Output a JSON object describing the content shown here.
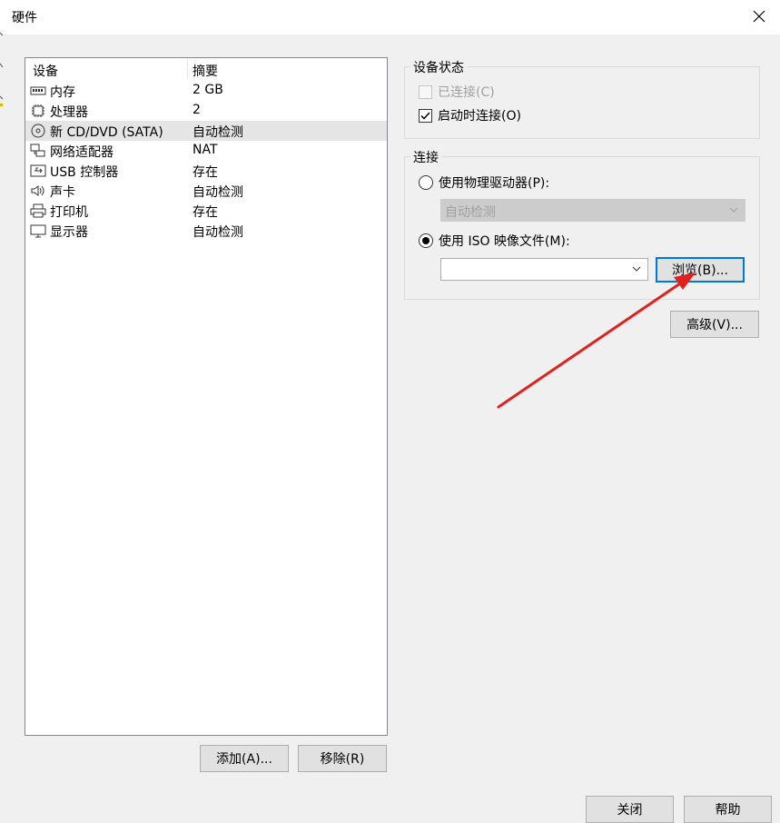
{
  "window": {
    "title": "硬件"
  },
  "device_list": {
    "columns": [
      "设备",
      "摘要"
    ],
    "rows": [
      {
        "name": "内存",
        "summary": "2 GB",
        "icon": "memory-icon",
        "selected": false
      },
      {
        "name": "处理器",
        "summary": "2",
        "icon": "cpu-icon",
        "selected": false
      },
      {
        "name": "新 CD/DVD (SATA)",
        "summary": "自动检测",
        "icon": "cd-dvd-icon",
        "selected": true
      },
      {
        "name": "网络适配器",
        "summary": "NAT",
        "icon": "network-adapter-icon",
        "selected": false
      },
      {
        "name": "USB 控制器",
        "summary": "存在",
        "icon": "usb-icon",
        "selected": false
      },
      {
        "name": "声卡",
        "summary": "自动检测",
        "icon": "speaker-icon",
        "selected": false
      },
      {
        "name": "打印机",
        "summary": "存在",
        "icon": "printer-icon",
        "selected": false
      },
      {
        "name": "显示器",
        "summary": "自动检测",
        "icon": "monitor-icon",
        "selected": false
      }
    ],
    "add_label": "添加(A)...",
    "remove_label": "移除(R)"
  },
  "device_status": {
    "title": "设备状态",
    "connected_label": "已连接(C)",
    "connected_checked": false,
    "connected_disabled": true,
    "connect_at_poweron_label": "启动时连接(O)",
    "connect_at_poweron_checked": true
  },
  "connection": {
    "title": "连接",
    "physical_drive_label": "使用物理驱动器(P):",
    "physical_drive_value": "自动检测",
    "iso_label": "使用 ISO 映像文件(M):",
    "iso_value": "",
    "selected": "iso",
    "browse_label": "浏览(B)..."
  },
  "advanced_label": "高级(V)...",
  "footer": {
    "close_label": "关闭",
    "help_label": "帮助"
  },
  "colors": {
    "annotation_arrow": "#e0211d",
    "focus_blue": "#0078d7"
  }
}
